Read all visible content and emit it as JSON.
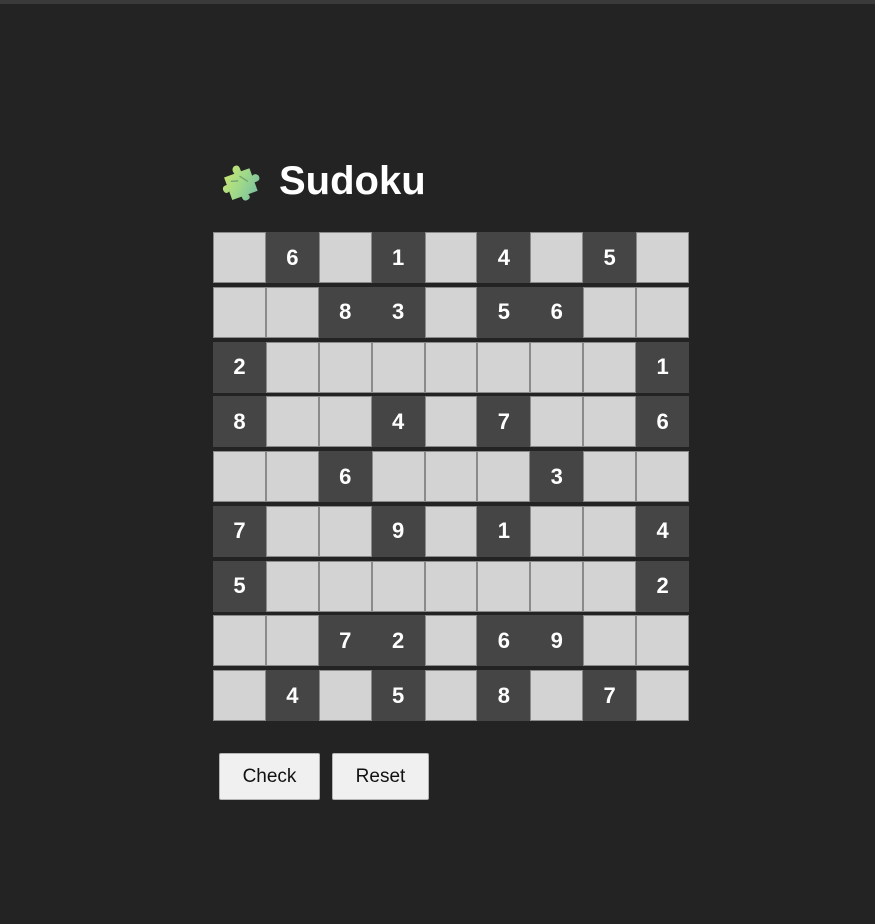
{
  "header": {
    "icon": "puzzle-piece-icon",
    "title": "Sudoku"
  },
  "board": {
    "rows": [
      [
        "",
        "6",
        "",
        "1",
        "",
        "4",
        "",
        "5",
        ""
      ],
      [
        "",
        "",
        "8",
        "3",
        "",
        "5",
        "6",
        "",
        ""
      ],
      [
        "2",
        "",
        "",
        "",
        "",
        "",
        "",
        "",
        "1"
      ],
      [
        "8",
        "",
        "",
        "4",
        "",
        "7",
        "",
        "",
        "6"
      ],
      [
        "",
        "",
        "6",
        "",
        "",
        "",
        "3",
        "",
        ""
      ],
      [
        "7",
        "",
        "",
        "9",
        "",
        "1",
        "",
        "",
        "4"
      ],
      [
        "5",
        "",
        "",
        "",
        "",
        "",
        "",
        "",
        "2"
      ],
      [
        "",
        "",
        "7",
        "2",
        "",
        "6",
        "9",
        "",
        ""
      ],
      [
        "",
        "4",
        "",
        "5",
        "",
        "8",
        "",
        "7",
        ""
      ]
    ]
  },
  "buttons": {
    "check_label": "Check",
    "reset_label": "Reset"
  },
  "colors": {
    "background": "#232323",
    "given_cell": "#454545",
    "empty_cell": "#d3d3d3",
    "digit": "#ffffff"
  }
}
